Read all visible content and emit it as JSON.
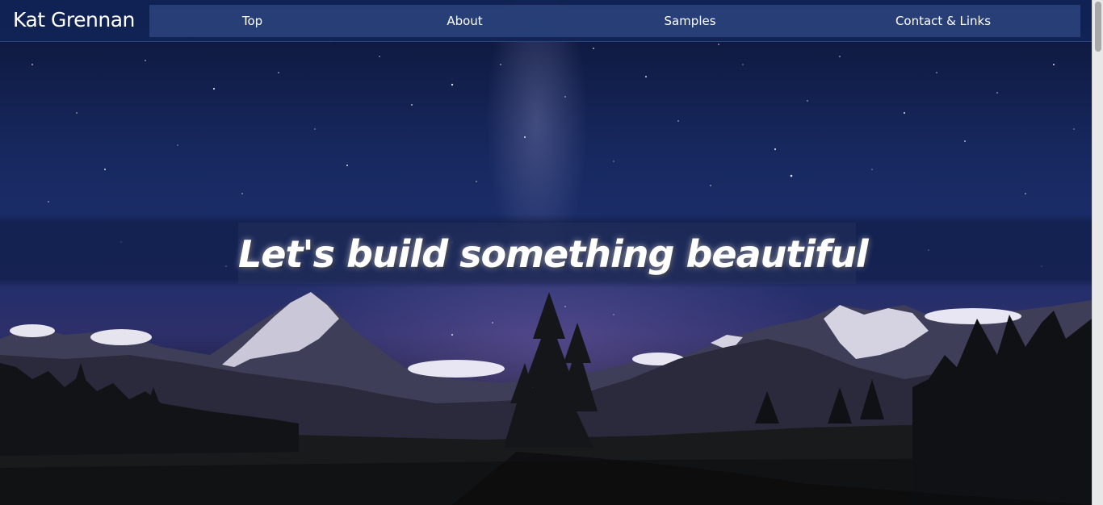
{
  "brand": {
    "name": "Kat Grennan"
  },
  "nav": {
    "top": "Top",
    "about": "About",
    "samples": "Samples",
    "contact": "Contact & Links"
  },
  "hero": {
    "tagline": "Let's build something beautiful"
  },
  "colors": {
    "navbar": "#102456",
    "nav_links_bg": "#3a5694",
    "text": "#ffffff",
    "sky": "#1d2f6c"
  }
}
